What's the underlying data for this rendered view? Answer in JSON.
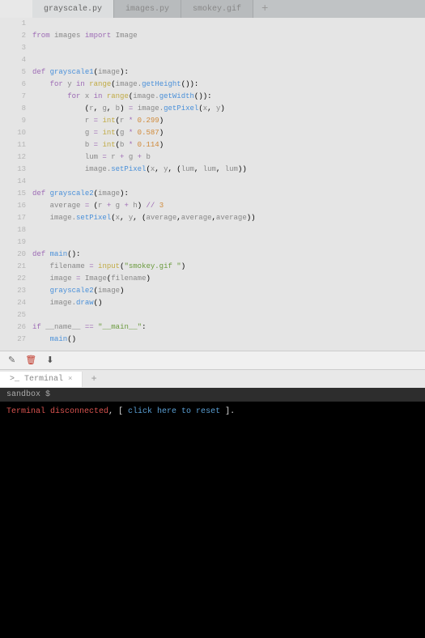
{
  "tabs": {
    "items": [
      {
        "label": "grayscale.py",
        "active": true
      },
      {
        "label": "images.py",
        "active": false
      },
      {
        "label": "smokey.gif",
        "active": false
      }
    ],
    "add": "+"
  },
  "code": {
    "lines": [
      {
        "n": 1,
        "t": "blank"
      },
      {
        "n": 2,
        "t": "import"
      },
      {
        "n": 3,
        "t": "blank"
      },
      {
        "n": 4,
        "t": "blank"
      },
      {
        "n": 5,
        "t": "def1"
      },
      {
        "n": 6,
        "t": "for_y"
      },
      {
        "n": 7,
        "t": "for_x"
      },
      {
        "n": 8,
        "t": "rgb"
      },
      {
        "n": 9,
        "t": "r"
      },
      {
        "n": 10,
        "t": "g"
      },
      {
        "n": 11,
        "t": "b"
      },
      {
        "n": 12,
        "t": "lum"
      },
      {
        "n": 13,
        "t": "setpixel1"
      },
      {
        "n": 14,
        "t": "blank"
      },
      {
        "n": 15,
        "t": "def2"
      },
      {
        "n": 16,
        "t": "avg"
      },
      {
        "n": 17,
        "t": "setpixel2"
      },
      {
        "n": 18,
        "t": "blank"
      },
      {
        "n": 19,
        "t": "blank"
      },
      {
        "n": 20,
        "t": "defmain"
      },
      {
        "n": 21,
        "t": "filename"
      },
      {
        "n": 22,
        "t": "imagenew"
      },
      {
        "n": 23,
        "t": "callgs2"
      },
      {
        "n": 24,
        "t": "draw"
      },
      {
        "n": 25,
        "t": "blank"
      },
      {
        "n": 26,
        "t": "ifmain"
      },
      {
        "n": 27,
        "t": "callmain"
      }
    ],
    "tokens": {
      "from": "from",
      "import": "import",
      "images": "images",
      "Image": "Image",
      "def": "def",
      "for": "for",
      "in": "in",
      "if": "if",
      "range": "range",
      "int": "int",
      "input": "input",
      "grayscale1": "grayscale1",
      "grayscale2": "grayscale2",
      "main": "main",
      "image": "image",
      "getHeight": "getHeight",
      "getWidth": "getWidth",
      "getPixel": "getPixel",
      "setPixel": "setPixel",
      "draw": "draw",
      "y": "y",
      "x": "x",
      "r": "r",
      "g": "g",
      "b": "b",
      "h": "h",
      "lum": "lum",
      "filename": "filename",
      "average": "average",
      "n0299": "0.299",
      "n0587": "0.587",
      "n0114": "0.114",
      "n3": "3",
      "slashslash": "//",
      "str_smokey": "\"smokey.gif \"",
      "dunder_name": "__name__",
      "dunder_main": "\"__main__\""
    }
  },
  "terminal": {
    "tab_label": "Terminal",
    "prompt_glyph": ">_",
    "add": "+",
    "close": "×",
    "header": "sandbox $",
    "line1_red": "Terminal disconnected",
    "line1_mid": ", [ ",
    "line1_link": "click here to reset",
    "line1_end": " ]."
  }
}
